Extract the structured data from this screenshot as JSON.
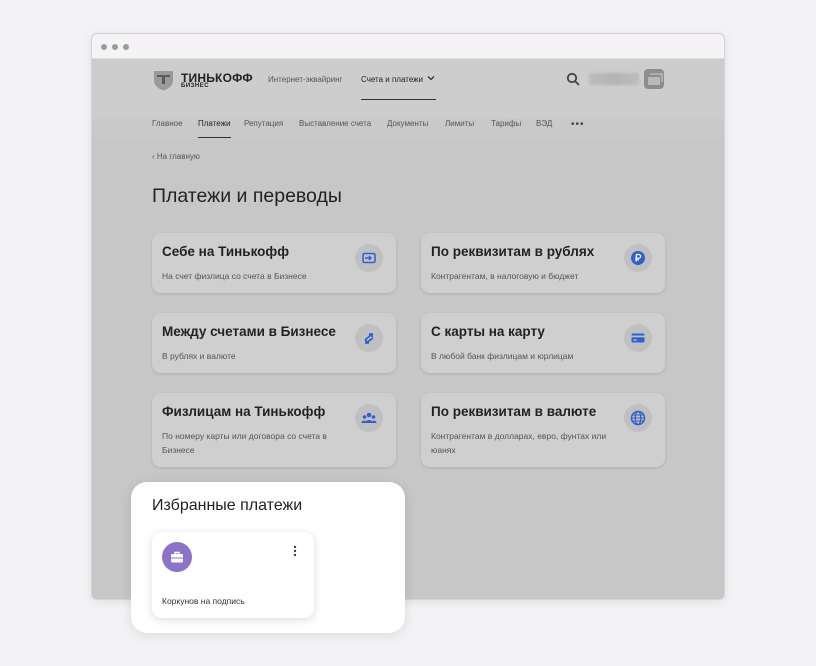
{
  "header": {
    "logo_line1": "ТИНЬКОФФ",
    "logo_line2": "БИЗНЕС",
    "nav": [
      "Интернет-эквайринг",
      "Счета и платежи"
    ]
  },
  "subnav": [
    "Главное",
    "Платежи",
    "Репутация",
    "Выставление счета",
    "Документы",
    "Лимиты",
    "Тарифы",
    "ВЭД"
  ],
  "subnav_more": "•••",
  "back_label": "На главную",
  "page_title": "Платежи и переводы",
  "cards": [
    {
      "title": "Себе на Тинькофф",
      "desc": "На счет физлица со счета в Бизнесе",
      "icon": "card-transfer-icon"
    },
    {
      "title": "По реквизитам в рублях",
      "desc": "Контрагентам, в налоговую и бюджет",
      "icon": "ruble-icon"
    },
    {
      "title": "Между счетами в Бизнесе",
      "desc": "В рублях и валюте",
      "icon": "exchange-arrows-icon"
    },
    {
      "title": "С карты на карту",
      "desc": "В любой банк физлицам и юрлицам",
      "icon": "credit-card-icon"
    },
    {
      "title": "Физлицам на Тинькофф",
      "desc": "По номеру карты или договора со счета в Бизнесе",
      "icon": "people-icon"
    },
    {
      "title": "По реквизитам в валюте",
      "desc": "Контрагентам в долларах, евро, фунтах или юанях",
      "icon": "globe-icon"
    }
  ],
  "favorites": {
    "title": "Избранные платежи",
    "items": [
      {
        "label": "Коркунов на подпись",
        "icon": "briefcase-icon"
      }
    ]
  },
  "colors": {
    "accent": "#2f5fd1",
    "favorite_icon": "#8c73c7"
  }
}
